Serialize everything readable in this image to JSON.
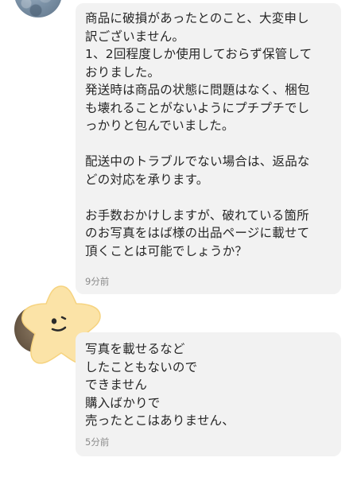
{
  "messages": [
    {
      "sender": "other",
      "avatar_icon": "user-avatar-icon",
      "text": "商品に破損があったとのこと、大変申し\n訳ございません。\n1、2回程度しか使用しておらず保管して\nおりました。\n発送時は商品の状態に問題はなく、梱包\nも壊れることがないようにプチプチでし\nっかりと包んでいました。\n\n配送中のトラブルでない場合は、返品な\nどの対応を承ります。\n\nお手数おかけしますが、破れている箇所\nのお写真をはば様の出品ページに載せて\n頂くことは可能でしょうか？",
      "time": "9分前"
    },
    {
      "sender": "other",
      "avatar_icon": "sticker-face-icon",
      "text": "写真を載せるなど\nしたこともないので\nできません\n購入ばかりで\n売ったとこはありません、",
      "time": "5分前"
    }
  ],
  "colors": {
    "bubble": "#f2f2f2",
    "text": "#262626",
    "time": "#8a8a8a",
    "sticker": "#fbe3a7"
  }
}
